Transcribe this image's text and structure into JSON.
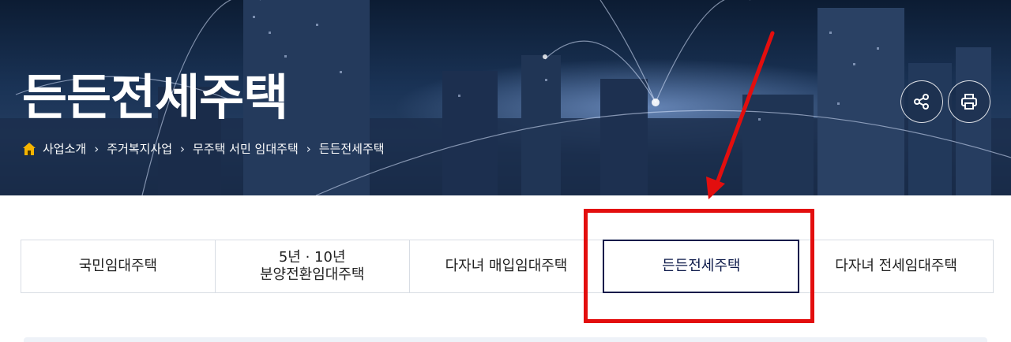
{
  "header": {
    "title": "든든전세주택",
    "breadcrumb": [
      "사업소개",
      "주거복지사업",
      "무주택 서민 임대주택",
      "든든전세주택"
    ],
    "share_icon": "share-icon",
    "print_icon": "print-icon"
  },
  "tabs": [
    {
      "label": "국민임대주택"
    },
    {
      "label_line1": "5년 · 10년",
      "label_line2": "분양전환임대주택"
    },
    {
      "label": "다자녀 매입임대주택"
    },
    {
      "label": "든든전세주택",
      "active": true
    },
    {
      "label": "다자녀 전세임대주택"
    }
  ],
  "colors": {
    "accent": "#0d1a4a",
    "annotation": "#e30e0e",
    "home_icon": "#f5b400"
  }
}
